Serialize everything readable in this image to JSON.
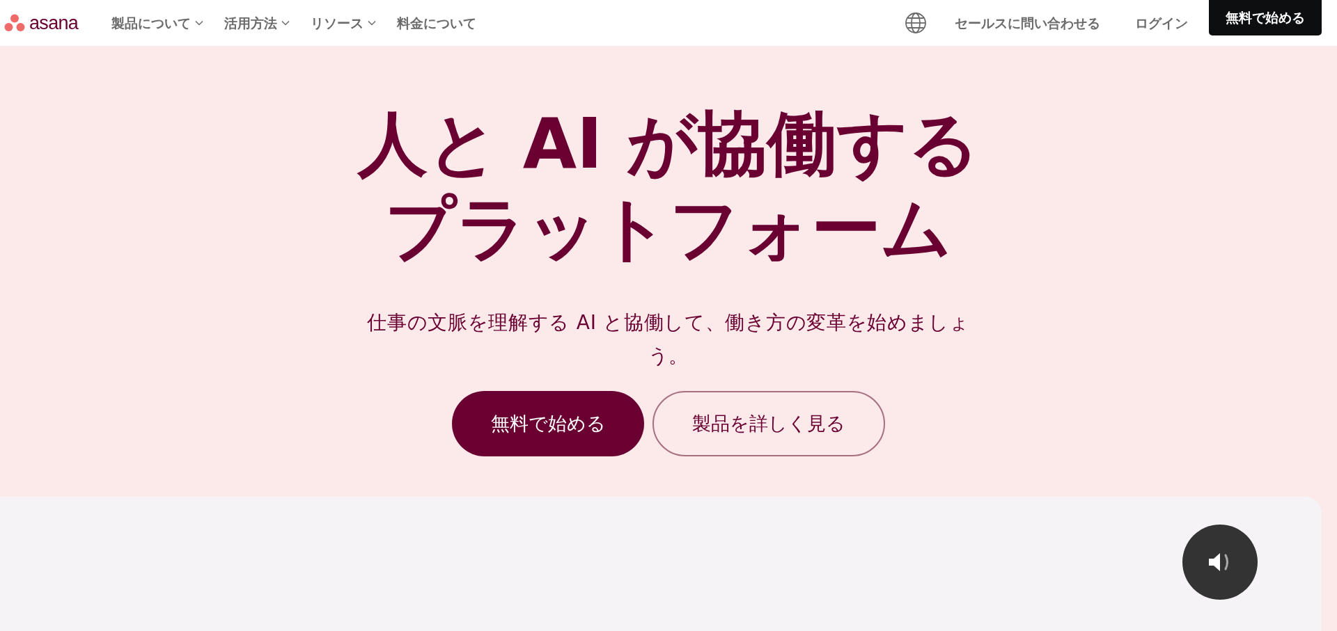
{
  "header": {
    "logo": "asana",
    "nav": [
      {
        "label": "製品について",
        "dropdown": true
      },
      {
        "label": "活用方法",
        "dropdown": true
      },
      {
        "label": "リソース",
        "dropdown": true
      },
      {
        "label": "料金について",
        "dropdown": false
      }
    ],
    "contact_sales": "セールスに問い合わせる",
    "login": "ログイン",
    "cta": "無料で始める"
  },
  "hero": {
    "title_lines": [
      "人と AI が協働する",
      "プラットフォーム"
    ],
    "subtitle": "仕事の文脈を理解する AI と協働して、働き方の変革を始めましょう。",
    "primary_button": "無料で始める",
    "secondary_button": "製品を詳しく見る"
  },
  "video": {
    "muted": false
  }
}
